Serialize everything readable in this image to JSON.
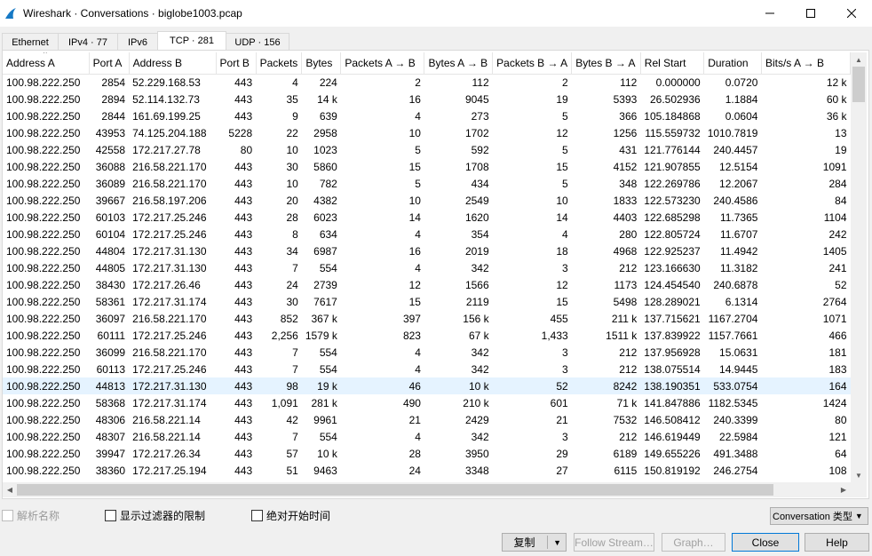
{
  "window": {
    "title": "Wireshark · Conversations · biglobe1003.pcap",
    "minimize": "—",
    "maximize": "☐",
    "close": "✕"
  },
  "tabs": [
    {
      "label": "Ethernet"
    },
    {
      "label": "IPv4 · 77"
    },
    {
      "label": "IPv6"
    },
    {
      "label": "TCP · 281"
    },
    {
      "label": "UDP · 156"
    }
  ],
  "columns": [
    "Address A",
    "Port A",
    "Address B",
    "Port B",
    "Packets",
    "Bytes",
    "Packets A → B",
    "Bytes A → B",
    "Packets B → A",
    "Bytes B → A",
    "Rel Start",
    "Duration",
    "Bits/s A → B"
  ],
  "rows": [
    [
      "100.98.222.250",
      "2854",
      "52.229.168.53",
      "443",
      "4",
      "224",
      "2",
      "112",
      "2",
      "112",
      "0.000000",
      "0.0720",
      "12 k"
    ],
    [
      "100.98.222.250",
      "2894",
      "52.114.132.73",
      "443",
      "35",
      "14 k",
      "16",
      "9045",
      "19",
      "5393",
      "26.502936",
      "1.1884",
      "60 k"
    ],
    [
      "100.98.222.250",
      "2844",
      "161.69.199.25",
      "443",
      "9",
      "639",
      "4",
      "273",
      "5",
      "366",
      "105.184868",
      "0.0604",
      "36 k"
    ],
    [
      "100.98.222.250",
      "43953",
      "74.125.204.188",
      "5228",
      "22",
      "2958",
      "10",
      "1702",
      "12",
      "1256",
      "115.559732",
      "1010.7819",
      "13"
    ],
    [
      "100.98.222.250",
      "42558",
      "172.217.27.78",
      "80",
      "10",
      "1023",
      "5",
      "592",
      "5",
      "431",
      "121.776144",
      "240.4457",
      "19"
    ],
    [
      "100.98.222.250",
      "36088",
      "216.58.221.170",
      "443",
      "30",
      "5860",
      "15",
      "1708",
      "15",
      "4152",
      "121.907855",
      "12.5154",
      "1091"
    ],
    [
      "100.98.222.250",
      "36089",
      "216.58.221.170",
      "443",
      "10",
      "782",
      "5",
      "434",
      "5",
      "348",
      "122.269786",
      "12.2067",
      "284"
    ],
    [
      "100.98.222.250",
      "39667",
      "216.58.197.206",
      "443",
      "20",
      "4382",
      "10",
      "2549",
      "10",
      "1833",
      "122.573230",
      "240.4586",
      "84"
    ],
    [
      "100.98.222.250",
      "60103",
      "172.217.25.246",
      "443",
      "28",
      "6023",
      "14",
      "1620",
      "14",
      "4403",
      "122.685298",
      "11.7365",
      "1104"
    ],
    [
      "100.98.222.250",
      "60104",
      "172.217.25.246",
      "443",
      "8",
      "634",
      "4",
      "354",
      "4",
      "280",
      "122.805724",
      "11.6707",
      "242"
    ],
    [
      "100.98.222.250",
      "44804",
      "172.217.31.130",
      "443",
      "34",
      "6987",
      "16",
      "2019",
      "18",
      "4968",
      "122.925237",
      "11.4942",
      "1405"
    ],
    [
      "100.98.222.250",
      "44805",
      "172.217.31.130",
      "443",
      "7",
      "554",
      "4",
      "342",
      "3",
      "212",
      "123.166630",
      "11.3182",
      "241"
    ],
    [
      "100.98.222.250",
      "38430",
      "172.217.26.46",
      "443",
      "24",
      "2739",
      "12",
      "1566",
      "12",
      "1173",
      "124.454540",
      "240.6878",
      "52"
    ],
    [
      "100.98.222.250",
      "58361",
      "172.217.31.174",
      "443",
      "30",
      "7617",
      "15",
      "2119",
      "15",
      "5498",
      "128.289021",
      "6.1314",
      "2764"
    ],
    [
      "100.98.222.250",
      "36097",
      "216.58.221.170",
      "443",
      "852",
      "367 k",
      "397",
      "156 k",
      "455",
      "211 k",
      "137.715621",
      "1167.2704",
      "1071"
    ],
    [
      "100.98.222.250",
      "60111",
      "172.217.25.246",
      "443",
      "2,256",
      "1579 k",
      "823",
      "67 k",
      "1,433",
      "1511 k",
      "137.839922",
      "1157.7661",
      "466"
    ],
    [
      "100.98.222.250",
      "36099",
      "216.58.221.170",
      "443",
      "7",
      "554",
      "4",
      "342",
      "3",
      "212",
      "137.956928",
      "15.0631",
      "181"
    ],
    [
      "100.98.222.250",
      "60113",
      "172.217.25.246",
      "443",
      "7",
      "554",
      "4",
      "342",
      "3",
      "212",
      "138.075514",
      "14.9445",
      "183"
    ],
    [
      "100.98.222.250",
      "44813",
      "172.217.31.130",
      "443",
      "98",
      "19 k",
      "46",
      "10 k",
      "52",
      "8242",
      "138.190351",
      "533.0754",
      "164"
    ],
    [
      "100.98.222.250",
      "58368",
      "172.217.31.174",
      "443",
      "1,091",
      "281 k",
      "490",
      "210 k",
      "601",
      "71 k",
      "141.847886",
      "1182.5345",
      "1424"
    ],
    [
      "100.98.222.250",
      "48306",
      "216.58.221.14",
      "443",
      "42",
      "9961",
      "21",
      "2429",
      "21",
      "7532",
      "146.508412",
      "240.3399",
      "80"
    ],
    [
      "100.98.222.250",
      "48307",
      "216.58.221.14",
      "443",
      "7",
      "554",
      "4",
      "342",
      "3",
      "212",
      "146.619449",
      "22.5984",
      "121"
    ],
    [
      "100.98.222.250",
      "39947",
      "172.217.26.34",
      "443",
      "57",
      "10 k",
      "28",
      "3950",
      "29",
      "6189",
      "149.655226",
      "491.3488",
      "64"
    ],
    [
      "100.98.222.250",
      "38360",
      "172.217.25.194",
      "443",
      "51",
      "9463",
      "24",
      "3348",
      "27",
      "6115",
      "150.819192",
      "246.2754",
      "108"
    ]
  ],
  "selected_row": 18,
  "options": {
    "name_resolution": "解析名称",
    "limit_to_filter": "显示过滤器的限制",
    "absolute_start": "绝对开始时间"
  },
  "conversation_type": "Conversation 类型",
  "buttons": {
    "copy": "复制",
    "follow_stream": "Follow Stream…",
    "graph": "Graph…",
    "close": "Close",
    "help": "Help"
  }
}
